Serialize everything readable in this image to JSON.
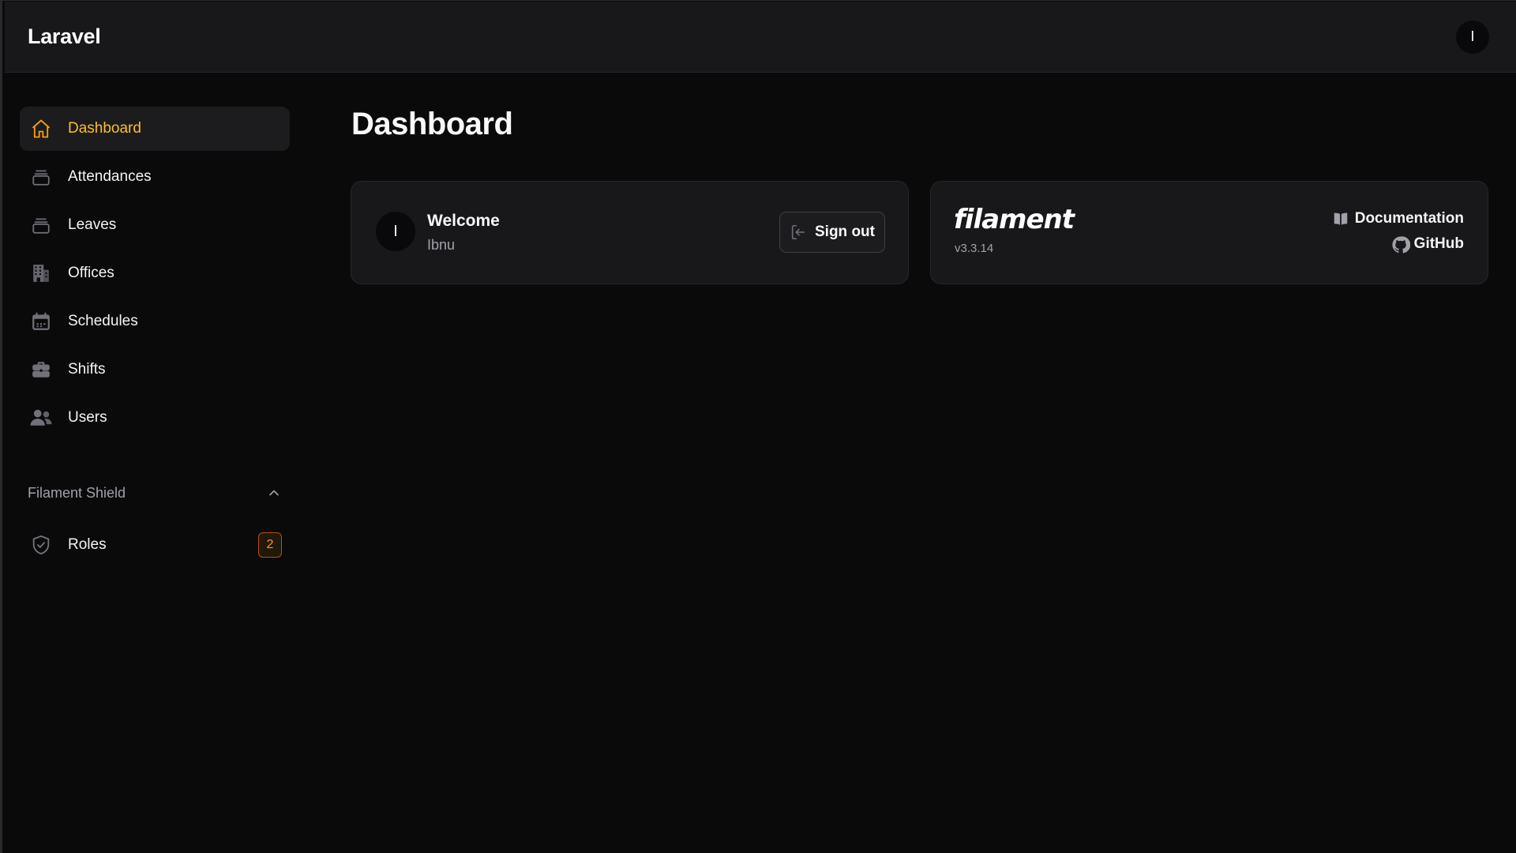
{
  "app": {
    "brand": "Laravel",
    "user_initial": "I"
  },
  "sidebar": {
    "items": [
      {
        "label": "Dashboard",
        "icon": "home-icon",
        "active": true
      },
      {
        "label": "Attendances",
        "icon": "inbox-stack-icon"
      },
      {
        "label": "Leaves",
        "icon": "inbox-stack-icon"
      },
      {
        "label": "Offices",
        "icon": "building-office-icon"
      },
      {
        "label": "Schedules",
        "icon": "calendar-icon"
      },
      {
        "label": "Shifts",
        "icon": "briefcase-icon"
      },
      {
        "label": "Users",
        "icon": "users-icon"
      }
    ],
    "group": {
      "label": "Filament Shield",
      "items": [
        {
          "label": "Roles",
          "icon": "shield-check-icon",
          "badge": "2"
        }
      ]
    }
  },
  "page": {
    "title": "Dashboard"
  },
  "welcome_card": {
    "title": "Welcome",
    "name": "Ibnu",
    "avatar_initial": "I",
    "signout_label": "Sign out"
  },
  "filament_card": {
    "logo": "filament",
    "version": "v3.3.14",
    "docs_label": "Documentation",
    "github_label": "GitHub"
  },
  "colors": {
    "accent": "#f59e0b",
    "background": "#0a0a0b",
    "surface": "#18181b"
  }
}
